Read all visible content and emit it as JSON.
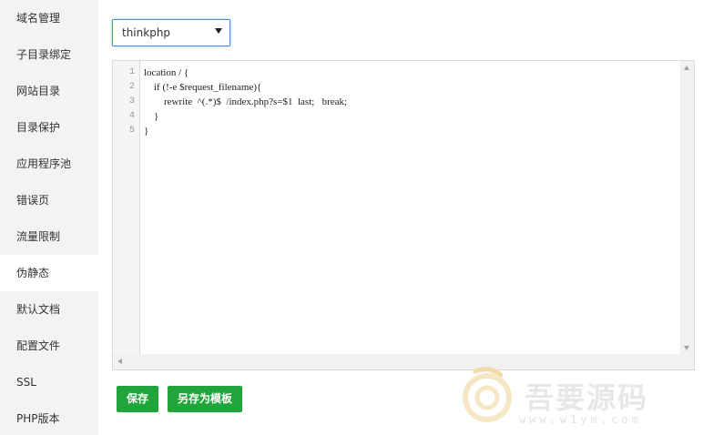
{
  "sidebar": {
    "items": [
      {
        "label": "域名管理"
      },
      {
        "label": "子目录绑定"
      },
      {
        "label": "网站目录"
      },
      {
        "label": "目录保护"
      },
      {
        "label": "应用程序池"
      },
      {
        "label": "错误页"
      },
      {
        "label": "流量限制"
      },
      {
        "label": "伪静态"
      },
      {
        "label": "默认文档"
      },
      {
        "label": "配置文件"
      },
      {
        "label": "SSL"
      },
      {
        "label": "PHP版本"
      }
    ],
    "active_index": 7
  },
  "rewrite": {
    "selected_template": "thinkphp"
  },
  "editor": {
    "line_numbers": [
      "1",
      "2",
      "3",
      "4",
      "5"
    ],
    "lines": [
      "location / {",
      "    if (!-e $request_filename){",
      "        rewrite  ^(.*)$  /index.php?s=$1  last;   break;",
      "    }",
      "}"
    ]
  },
  "buttons": {
    "save_label": "保存",
    "save_as_template_label": "另存为模板"
  },
  "watermark": {
    "brand": "吾要源码",
    "url": "www.w1ym.com"
  },
  "colors": {
    "accent_green": "#20a53a",
    "select_focus_blue": "#4a8fd8",
    "sidebar_bg": "#f3f3f3"
  }
}
